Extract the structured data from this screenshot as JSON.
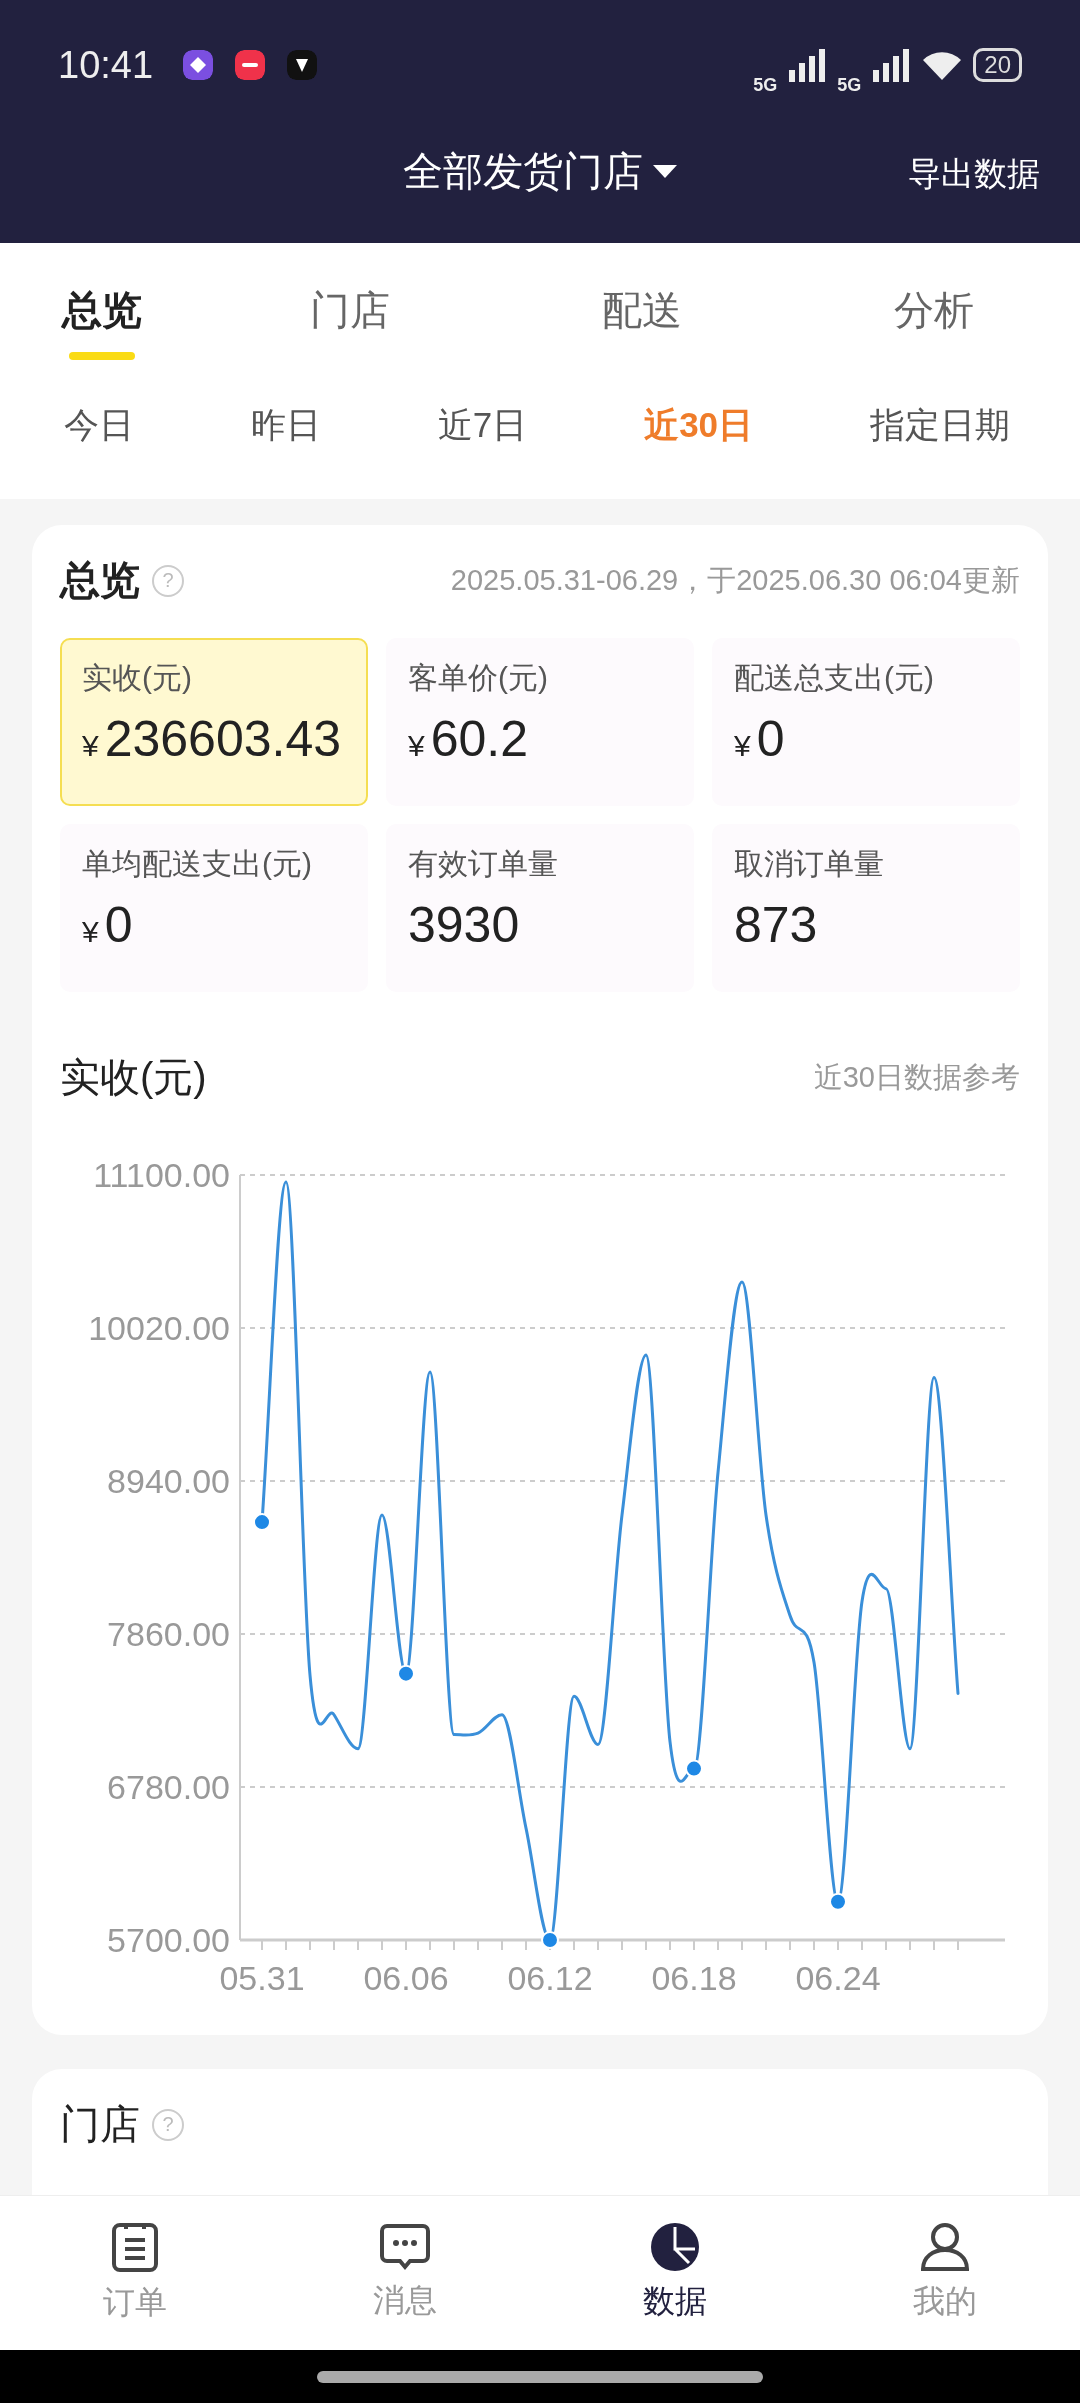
{
  "status_bar": {
    "time": "10:41",
    "network": "5G",
    "network_2": "5G",
    "battery": "20"
  },
  "header": {
    "title": "全部发货门店",
    "action": "导出数据"
  },
  "tabs": [
    {
      "label": "总览",
      "selected": true
    },
    {
      "label": "门店",
      "selected": false
    },
    {
      "label": "配送",
      "selected": false
    },
    {
      "label": "分析",
      "selected": false
    }
  ],
  "date_filters": [
    {
      "label": "今日",
      "selected": false
    },
    {
      "label": "昨日",
      "selected": false
    },
    {
      "label": "近7日",
      "selected": false
    },
    {
      "label": "近30日",
      "selected": true
    },
    {
      "label": "指定日期",
      "selected": false
    }
  ],
  "overview": {
    "title": "总览",
    "help": "?",
    "range_note": "2025.05.31-06.29，于2025.06.30 06:04更新",
    "metrics": [
      {
        "label": "实收(元)",
        "currency": "¥",
        "value": "236603.43",
        "selected": true
      },
      {
        "label": "客单价(元)",
        "currency": "¥",
        "value": "60.2",
        "selected": false
      },
      {
        "label": "配送总支出(元)",
        "currency": "¥",
        "value": "0",
        "selected": false
      },
      {
        "label": "单均配送支出(元)",
        "currency": "¥",
        "value": "0",
        "selected": false
      },
      {
        "label": "有效订单量",
        "value": "3930",
        "selected": false
      },
      {
        "label": "取消订单量",
        "value": "873",
        "selected": false
      }
    ]
  },
  "revenue_chart": {
    "title": "实收(元)",
    "note": "近30日数据参考",
    "chart_data": {
      "type": "line",
      "grid": true,
      "categories": [
        "05.31",
        null,
        null,
        null,
        null,
        null,
        "06.06",
        null,
        null,
        null,
        null,
        null,
        "06.12",
        null,
        null,
        null,
        null,
        null,
        "06.18",
        null,
        null,
        null,
        null,
        null,
        "06.24",
        null,
        null,
        null,
        null,
        null
      ],
      "series": [
        {
          "color": "#3a8fd9",
          "values": [
            8650,
            11050,
            7570,
            7290,
            7050,
            8700,
            7580,
            9710,
            7150,
            7160,
            7290,
            6490,
            5700,
            7420,
            7080,
            8700,
            9830,
            7100,
            6910,
            9000,
            10345,
            8700,
            7990,
            7660,
            5970,
            8090,
            8180,
            7050,
            9670,
            7440
          ]
        }
      ],
      "ylim": [
        5700,
        11100
      ],
      "yticks": [
        {
          "value": 5700,
          "label": "5700.00"
        },
        {
          "value": 6780,
          "label": "6780.00"
        },
        {
          "value": 7860,
          "label": "7860.00"
        },
        {
          "value": 8940,
          "label": "8940.00"
        },
        {
          "value": 10020,
          "label": "10020.00"
        },
        {
          "value": 11100,
          "label": "11100.00"
        }
      ]
    }
  },
  "store_section": {
    "title": "门店",
    "help": "?"
  },
  "bottom_nav": [
    {
      "label": "订单",
      "selected": false
    },
    {
      "label": "消息",
      "selected": false
    },
    {
      "label": "数据",
      "selected": true
    },
    {
      "label": "我的",
      "selected": false
    }
  ]
}
